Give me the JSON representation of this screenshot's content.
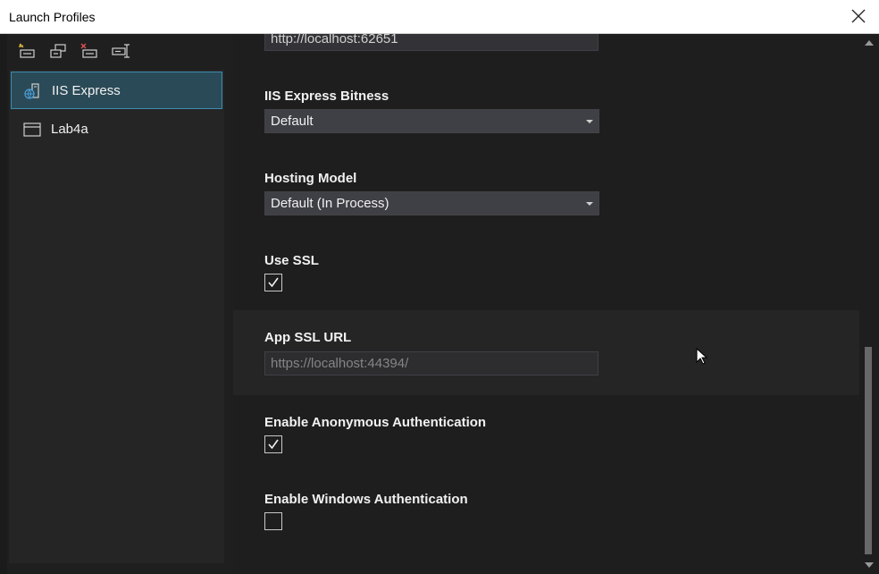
{
  "window": {
    "title": "Launch Profiles"
  },
  "toolbar": {
    "buttons": [
      {
        "icon": "new-profile-icon"
      },
      {
        "icon": "copy-profile-icon"
      },
      {
        "icon": "delete-profile-icon"
      },
      {
        "icon": "rename-profile-icon"
      }
    ]
  },
  "profiles": [
    {
      "label": "IIS Express",
      "icon": "iis-express-icon",
      "selected": true
    },
    {
      "label": "Lab4a",
      "icon": "window-icon",
      "selected": false
    }
  ],
  "settings": {
    "app_url": {
      "value": "http://localhost:62651"
    },
    "bitness": {
      "label": "IIS Express Bitness",
      "value": "Default"
    },
    "hosting_model": {
      "label": "Hosting Model",
      "value": "Default (In Process)"
    },
    "use_ssl": {
      "label": "Use SSL",
      "checked": true
    },
    "app_ssl_url": {
      "label": "App SSL URL",
      "value": "https://localhost:44394/"
    },
    "anonymous_auth": {
      "label": "Enable Anonymous Authentication",
      "checked": true
    },
    "windows_auth": {
      "label": "Enable Windows Authentication",
      "checked": false
    }
  },
  "colors": {
    "accent": "#3c8fb0",
    "selected_bg": "#2b4a57",
    "background": "#1e1e1e"
  }
}
